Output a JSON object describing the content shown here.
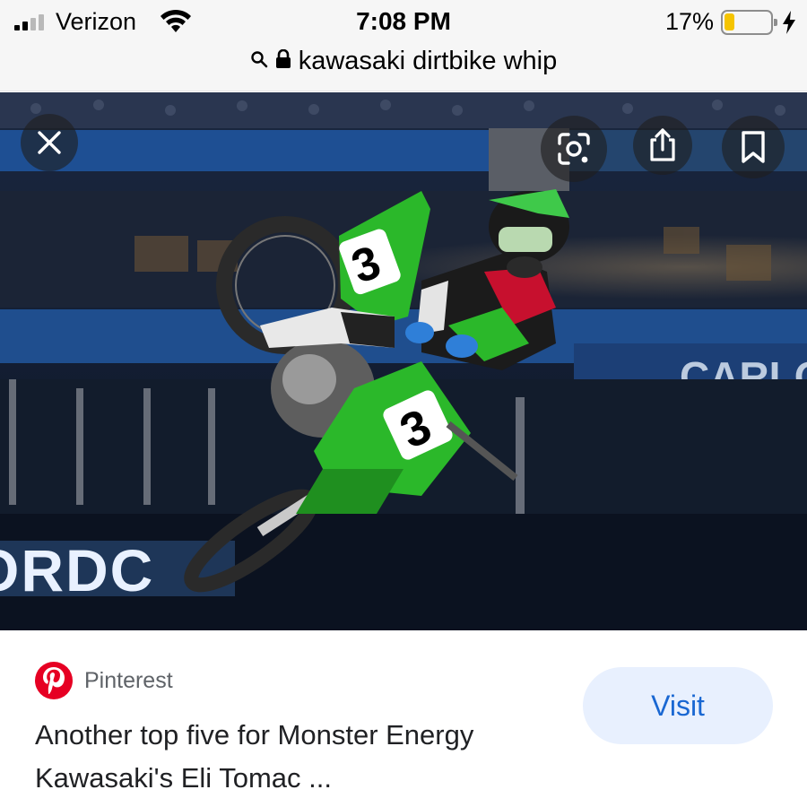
{
  "status_bar": {
    "carrier": "Verizon",
    "time": "7:08 PM",
    "battery_percent": "17%",
    "battery_level": 0.17,
    "signal_bars": 2
  },
  "address_bar": {
    "query": "kawasaki dirtbike whip",
    "search_icon": "search-icon",
    "lock_icon": "lock-icon"
  },
  "image_viewer": {
    "buttons": {
      "close": "close-icon",
      "lens": "lens-icon",
      "share": "share-icon",
      "save": "bookmark-icon"
    },
    "arena_sign": "CARLO",
    "board_text": "ORDC",
    "bike_number": "3"
  },
  "result": {
    "source": "Pinterest",
    "title_line1": "Another top five for Monster Energy",
    "title_line2": "Kawasaki's Eli Tomac ...",
    "visit_label": "Visit"
  },
  "colors": {
    "kawasaki_green": "#2bb82a",
    "pinterest_red": "#e60023",
    "visit_bg": "#e8f0fe",
    "visit_text": "#1967d2"
  }
}
